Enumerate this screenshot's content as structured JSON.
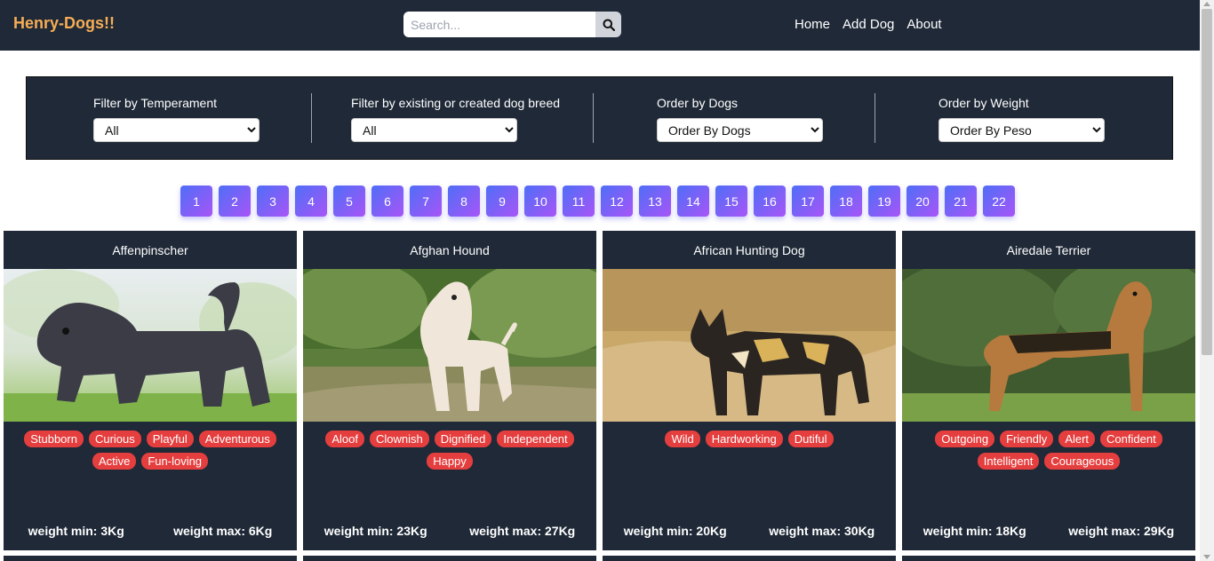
{
  "navbar": {
    "brand": "Henry-Dogs!!",
    "search_placeholder": "Search...",
    "links": [
      "Home",
      "Add Dog",
      "About"
    ]
  },
  "filters": {
    "temperament": {
      "label": "Filter by Temperament",
      "value": "All"
    },
    "source": {
      "label": "Filter by existing or created dog breed",
      "value": "All"
    },
    "order_dogs": {
      "label": "Order by Dogs",
      "value": "Order By Dogs"
    },
    "order_weight": {
      "label": "Order by Weight",
      "value": "Order By Peso"
    }
  },
  "pagination": [
    "1",
    "2",
    "3",
    "4",
    "5",
    "6",
    "7",
    "8",
    "9",
    "10",
    "11",
    "12",
    "13",
    "14",
    "15",
    "16",
    "17",
    "18",
    "19",
    "20",
    "21",
    "22"
  ],
  "cards": [
    {
      "name": "Affenpinscher",
      "temperaments": [
        "Stubborn",
        "Curious",
        "Playful",
        "Adventurous",
        "Active",
        "Fun-loving"
      ],
      "weight_min": "weight min: 3Kg",
      "weight_max": "weight max: 6Kg"
    },
    {
      "name": "Afghan Hound",
      "temperaments": [
        "Aloof",
        "Clownish",
        "Dignified",
        "Independent",
        "Happy"
      ],
      "weight_min": "weight min: 23Kg",
      "weight_max": "weight max: 27Kg"
    },
    {
      "name": "African Hunting Dog",
      "temperaments": [
        "Wild",
        "Hardworking",
        "Dutiful"
      ],
      "weight_min": "weight min: 20Kg",
      "weight_max": "weight max: 30Kg"
    },
    {
      "name": "Airedale Terrier",
      "temperaments": [
        "Outgoing",
        "Friendly",
        "Alert",
        "Confident",
        "Intelligent",
        "Courageous"
      ],
      "weight_min": "weight min: 18Kg",
      "weight_max": "weight max: 29Kg"
    }
  ],
  "colors": {
    "navbar_bg": "#1f2937",
    "brand": "#f6ad55",
    "badge": "#e53e3e",
    "page_gradient_start": "#4f6ef7",
    "page_gradient_end": "#a855f7"
  }
}
